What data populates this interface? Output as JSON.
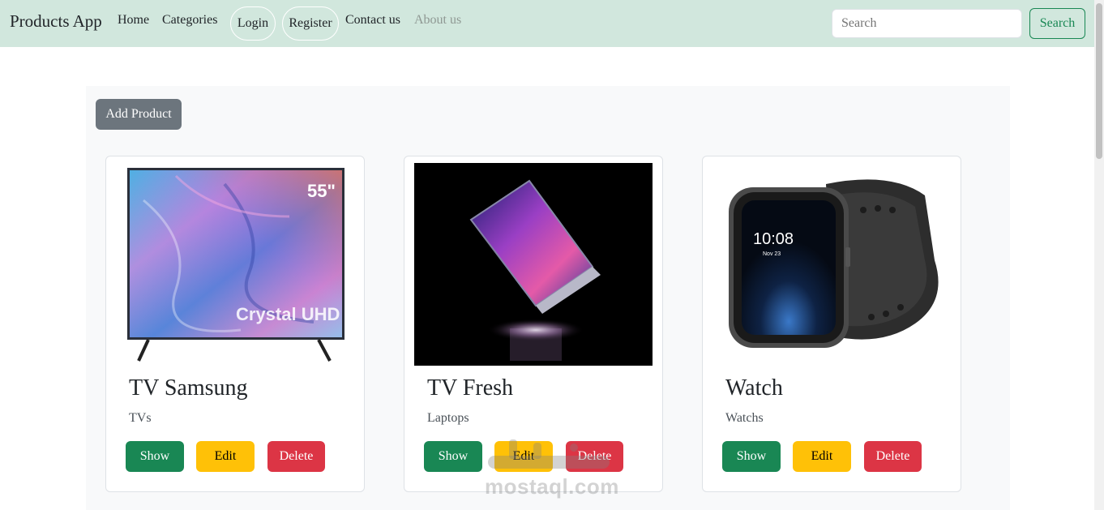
{
  "navbar": {
    "brand": "Products App",
    "links": {
      "home": "Home",
      "categories": "Categories",
      "login": "Login",
      "register": "Register",
      "contact": "Contact us",
      "about": "About us"
    },
    "search": {
      "placeholder": "Search",
      "button_label": "Search"
    }
  },
  "main": {
    "add_button_label": "Add Product",
    "products": [
      {
        "title": "TV Samsung",
        "category": "TVs",
        "image_icon": "tv-image",
        "image_text_size": "55\"",
        "image_text_brand": "Crystal UHD"
      },
      {
        "title": "TV Fresh",
        "category": "Laptops",
        "image_icon": "laptop-image"
      },
      {
        "title": "Watch",
        "category": "Watchs",
        "image_icon": "watch-image",
        "watch_time": "10:08",
        "watch_date": "Nov 23"
      }
    ],
    "actions": {
      "show": "Show",
      "edit": "Edit",
      "delete": "Delete"
    }
  },
  "watermark": "mostaql.com",
  "colors": {
    "navbar_bg": "#d1e7dd",
    "success": "#198754",
    "warning": "#ffc107",
    "danger": "#dc3545",
    "secondary": "#6c757d"
  }
}
